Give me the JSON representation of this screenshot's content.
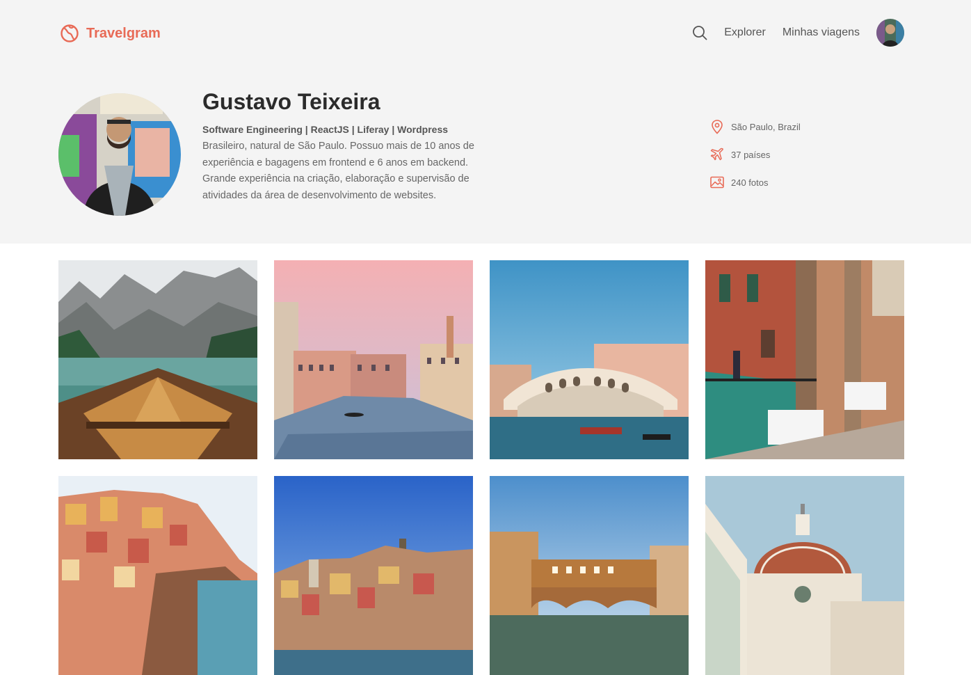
{
  "brand": {
    "name": "Travelgram",
    "icon": "globe-icon",
    "color": "#e86a56"
  },
  "nav": {
    "search_icon": "search-icon",
    "links": [
      "Explorer",
      "Minhas viagens"
    ],
    "avatar_icon": "user-avatar"
  },
  "profile": {
    "name": "Gustavo Teixeira",
    "headline": "Software Engineering | ReactJS | Liferay | Wordpress",
    "bio": "Brasileiro, natural de São Paulo. Possuo mais de 10 anos de experiência e bagagens em frontend e 6 anos em backend. Grande experiência na criação, elaboração e supervisão de atividades da área de desenvolvimento de websites."
  },
  "stats": [
    {
      "icon": "location-pin-icon",
      "label": "São Paulo, Brazil"
    },
    {
      "icon": "airplane-icon",
      "label": "37 países"
    },
    {
      "icon": "image-icon",
      "label": "240 fotos"
    }
  ],
  "photos": [
    "lake-boat-mountains-photo",
    "venice-canal-sunset-photo",
    "rialto-bridge-photo",
    "venice-canal-cafe-photo",
    "manarola-cliff-photo",
    "vernazza-coast-photo",
    "ponte-vecchio-photo",
    "florence-duomo-photo"
  ],
  "colors": {
    "header_bg": "#f4f4f4",
    "accent": "#e86a56",
    "text_dark": "#2b2b2b",
    "text_muted": "#666666"
  }
}
